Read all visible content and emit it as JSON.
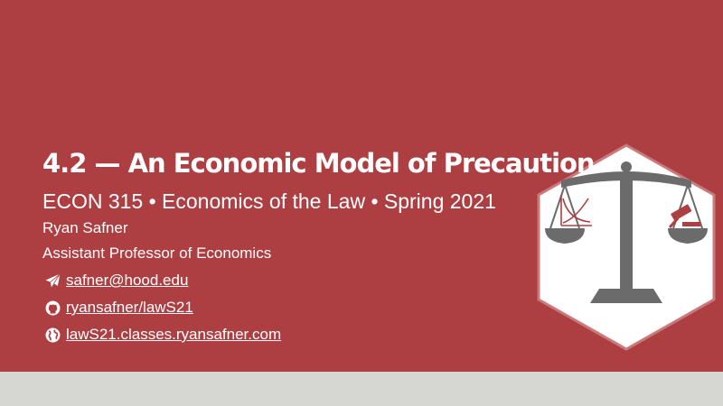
{
  "slide": {
    "title": "4.2 — An Economic Model of Precaution",
    "subtitle": "ECON 315 • Economics of the Law • Spring 2021",
    "author": "Ryan Safner",
    "position": "Assistant Professor of Economics",
    "contacts": [
      {
        "icon": "paper-plane-icon",
        "text": "safner@hood.edu"
      },
      {
        "icon": "github-icon",
        "text": "ryansafner/lawS21"
      },
      {
        "icon": "globe-icon",
        "text": "lawS21.classes.ryansafner.com"
      }
    ]
  },
  "logo": {
    "icon": "scales-of-justice-icon"
  },
  "colors": {
    "background": "#ad3f43",
    "footer": "#d6d6d3",
    "text": "#ffffff",
    "logo_gray": "#6b6b6b"
  }
}
